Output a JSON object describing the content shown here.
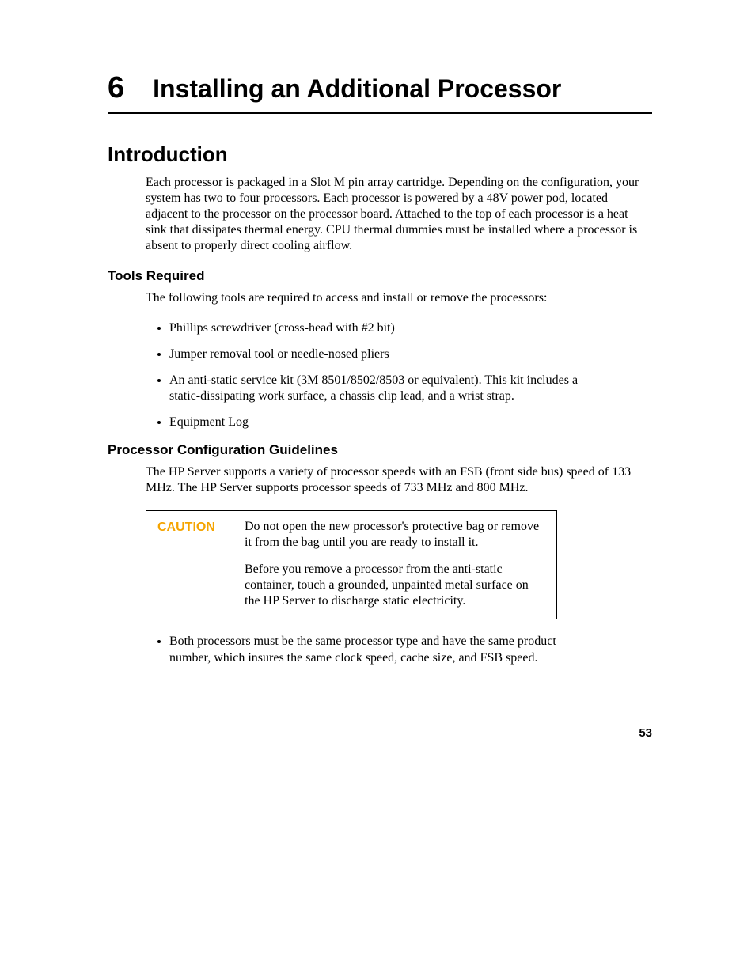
{
  "chapter": {
    "number": "6",
    "title": "Installing an Additional Processor"
  },
  "sections": {
    "intro": {
      "heading": "Introduction",
      "body": "Each processor is packaged in a Slot M pin array cartridge.  Depending on the configuration, your system has two to four processors. Each processor is powered by a 48V power pod, located adjacent to the processor on the processor board. Attached to the top of each processor is a heat sink that dissipates thermal energy. CPU thermal dummies must be installed where a processor is absent to properly direct cooling airflow."
    },
    "tools": {
      "heading": "Tools Required",
      "lead": "The following tools are required to access and install or remove the processors:",
      "items": [
        "Phillips screwdriver (cross-head with #2 bit)",
        "Jumper removal tool or needle-nosed pliers",
        "An anti-static service kit (3M 8501/8502/8503 or equivalent). This kit includes a static-dissipating work surface, a chassis clip lead, and a wrist strap.",
        "Equipment Log"
      ]
    },
    "guidelines": {
      "heading": "Processor Configuration Guidelines",
      "body": "The HP Server supports a variety of processor speeds with an FSB (front side bus) speed of 133 MHz. The HP Server supports processor speeds of 733 MHz and 800 MHz.",
      "caution": {
        "label": "CAUTION",
        "p1": "Do not open the new processor's protective bag or remove it from the bag until you are ready to install it.",
        "p2": "Before you remove a processor from the anti-static container, touch a grounded, unpainted metal surface on the HP Server to discharge static electricity."
      },
      "post_items": [
        "Both processors must be the same processor type and have the same product number, which insures the same clock speed, cache size, and FSB speed."
      ]
    }
  },
  "page_number": "53"
}
